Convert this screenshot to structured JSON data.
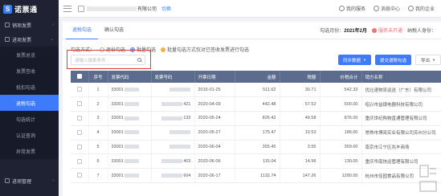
{
  "brand": {
    "logo_char": "S",
    "name": "诺票通"
  },
  "sidebar": {
    "groups": [
      {
        "label": "销项发票",
        "arrow": "›"
      },
      {
        "label": "进项发票",
        "arrow": "⌄"
      }
    ],
    "items": [
      {
        "label": "发票总览",
        "active": false
      },
      {
        "label": "发票签收",
        "active": false
      },
      {
        "label": "抵扣勾选",
        "active": false
      },
      {
        "label": "退税勾选",
        "active": true
      },
      {
        "label": "勾选统计",
        "active": false
      },
      {
        "label": "认证查询",
        "active": false
      },
      {
        "label": "异常发票",
        "active": false
      }
    ],
    "bottom_group": {
      "label": "进项管理",
      "arrow": "›"
    }
  },
  "header": {
    "company_suffix": "有限公司",
    "switch_label": "切换",
    "service_label": "我的服务",
    "messages_label": "消息中心",
    "company_label": "我的企业"
  },
  "tabs": [
    {
      "label": "退税勾选",
      "active": true
    },
    {
      "label": "确认勾选",
      "active": false
    }
  ],
  "status": {
    "period_label": "勾选月份：",
    "period_value": "2021年2月",
    "warning": "服务未开通",
    "taxpayer": "纳税人身份："
  },
  "method": {
    "label": "勾选方式：",
    "options": [
      {
        "label": "逐份勾选",
        "selected": false
      },
      {
        "label": "批量勾选",
        "selected": true
      }
    ],
    "hint": "批量勾选方式仅对已签收发票进行勾选"
  },
  "search": {
    "placeholder": "请输入搜索条件"
  },
  "actions": {
    "sync_label": "同步数据",
    "submit_label": "提交退税勾选",
    "export_label": "导出"
  },
  "table": {
    "columns": [
      "序号",
      "发票代码",
      "发票号码",
      "开票日期",
      "金额",
      "税额",
      "价税合计",
      "销方名称"
    ],
    "rows": [
      {
        "no": "1",
        "code": "33001",
        "number": "",
        "date": "2015-01-25",
        "amount": "511.62",
        "tax": "30.71",
        "total": "542.33",
        "seller": "优比速物流运送（广东）有限公司"
      },
      {
        "no": "2",
        "code": "33001",
        "number": "421",
        "date": "2020-04-09",
        "amount": "442.48",
        "tax": "57.52",
        "total": "500.00",
        "seller": "绍兴市益银电器科技有限公司"
      },
      {
        "no": "3",
        "code": "33001",
        "number": "132",
        "date": "2020-05-24",
        "amount": "826.42",
        "tax": "49.58",
        "total": "876.00",
        "seller": "重庆世纪购物直通管理有限公司"
      },
      {
        "no": "4",
        "code": "33001",
        "number": "",
        "date": "2020-05-27",
        "amount": "175.47",
        "tax": "10.53",
        "total": "186.00",
        "seller": "常熟市博亮实业有限公司苏州分公司"
      },
      {
        "no": "5",
        "code": "33001",
        "number": "",
        "date": "2020-06-04",
        "amount": "355.45",
        "tax": "3.55",
        "total": "359.00",
        "seller": "南京市江宁区兆丰商场"
      },
      {
        "no": "6",
        "code": "33001",
        "number": "403",
        "date": "2020-06-06",
        "amount": "115.04",
        "tax": "14.96",
        "total": "130.00",
        "seller": "重庆华南快运管理有限公司"
      },
      {
        "no": "7",
        "code": "33001",
        "number": "604",
        "date": "2020-06-17",
        "amount": "1132.74",
        "tax": "147.26",
        "total": "1280.00",
        "seller": "杭州市佳园食品有限公司"
      }
    ]
  },
  "colors": {
    "accent": "#3e7bfa",
    "sidebar_bg": "#1e2233",
    "table_header": "#5b6c8f",
    "highlight": "#e03c3c",
    "warning": "#f56c6c"
  }
}
